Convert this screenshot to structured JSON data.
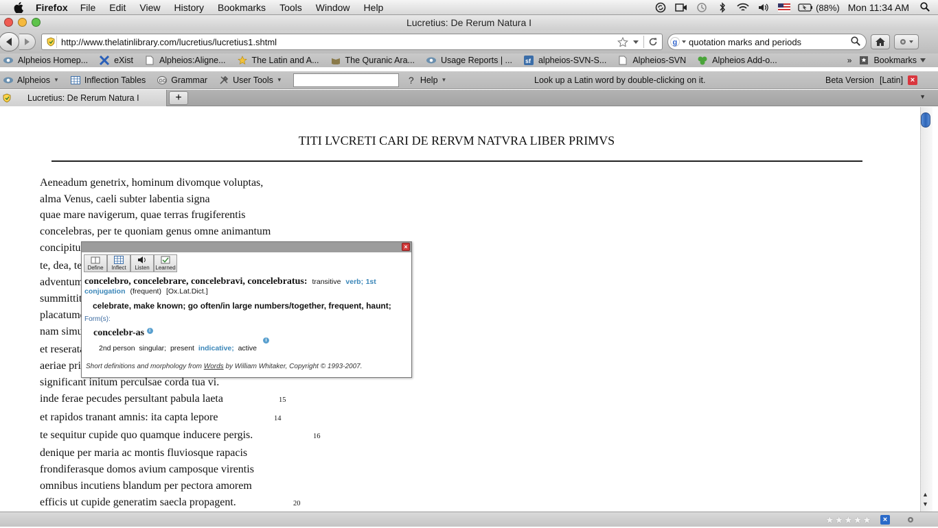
{
  "menubar": {
    "app": "Firefox",
    "items": [
      "File",
      "Edit",
      "View",
      "History",
      "Bookmarks",
      "Tools",
      "Window",
      "Help"
    ],
    "battery": "(88%)",
    "clock": "Mon 11:34 AM"
  },
  "window": {
    "title": "Lucretius: De Rerum Natura I"
  },
  "navbar": {
    "url": "http://www.thelatinlibrary.com/lucretius/lucretius1.shtml",
    "search_query": "quotation marks and periods"
  },
  "bookmarks": {
    "items": [
      {
        "label": "Alpheios Homep...",
        "icon": "alpheios-eye-icon"
      },
      {
        "label": "eXist",
        "icon": "exist-x-icon"
      },
      {
        "label": "Alpheios:Aligne...",
        "icon": "page-icon"
      },
      {
        "label": "The Latin and A...",
        "icon": "star-icon"
      },
      {
        "label": "The Quranic Ara...",
        "icon": "quran-icon"
      },
      {
        "label": "Usage Reports | ...",
        "icon": "alpheios-eye-icon"
      },
      {
        "label": "alpheios-SVN-S...",
        "icon": "sourceforge-icon"
      },
      {
        "label": "Alpheios-SVN",
        "icon": "page-icon"
      },
      {
        "label": "Alpheios Add-o...",
        "icon": "puzzle-icon"
      }
    ],
    "overflow": "»",
    "bookmarks_menu": "Bookmarks"
  },
  "alpheios_toolbar": {
    "alpheios": "Alpheios",
    "inflection_tables": "Inflection Tables",
    "grammar": "Grammar",
    "user_tools": "User Tools",
    "lookup_value": "",
    "help": "Help",
    "hint": "Look up a  Latin word by double-clicking on it.",
    "beta": "Beta Version",
    "language": "[Latin]"
  },
  "tabs": {
    "active": "Lucretius: De Rerum Natura I",
    "new_tab": "+"
  },
  "page": {
    "title": "TITI LVCRETI CARI DE RERVM NATVRA LIBER PRIMVS",
    "lines": [
      "Aeneadum genetrix, hominum divomque voluptas,",
      "alma Venus, caeli subter labentia signa",
      "quae mare navigerum, quae terras frugiferentis",
      "concelebras, per te quoniam genus omne animantum",
      "concipitur visitque exortum lumina solis:",
      "te, dea, te fugiunt venti, te nubila caeli",
      "adventumque tuum, tibi suavis daedala tellus",
      "summittit flores, tibi rident aequora ponti",
      "placatumque nitet diffuso lumine caelum.",
      "nam simul ac species patefactast verna diei",
      "et reserata viget genitabilis aura favoni,",
      "aeriae primum volucris te, diva, tuumque",
      "significant initum perculsae corda tua vi.",
      "inde ferae pecudes persultant pabula laeta",
      "et rapidos tranant amnis: ita capta lepore",
      "te sequitur cupide quo quamque inducere pergis.",
      "denique per maria ac montis fluviosque rapacis",
      "frondiferasque domos avium camposque virentis",
      "omnibus incutiens blandum per pectora amorem",
      "efficis ut cupide generatim saecla propagent."
    ],
    "line_numbers": {
      "l15": "15",
      "l14": "14",
      "l16": "16",
      "l20": "20"
    }
  },
  "popup": {
    "tools": [
      "Define",
      "Inflect",
      "Listen",
      "Learned"
    ],
    "headword": "concelebro, concelebrare, concelebravi, concelebratus:",
    "pos": "transitive",
    "conj_a": "verb;",
    "conj_b": "1st",
    "conj_c": "conjugation",
    "freq": "(frequent)",
    "source": "[Ox.Lat.Dict.]",
    "meaning": "celebrate, make known; go often/in large numbers/together, frequent, haunt;",
    "forms_label": "Form(s):",
    "inflection": "concelebr-as",
    "person": "2nd person",
    "number": "singular;",
    "tense": "present",
    "mood": "indicative;",
    "voice": "active",
    "credit_pre": "Short definitions and morphology from",
    "credit_link": "Words",
    "credit_post": "by William Whitaker, Copyright © 1993-2007."
  },
  "colors": {
    "alpheios_blue": "#3a86b8",
    "close_red": "#d13b3b"
  }
}
